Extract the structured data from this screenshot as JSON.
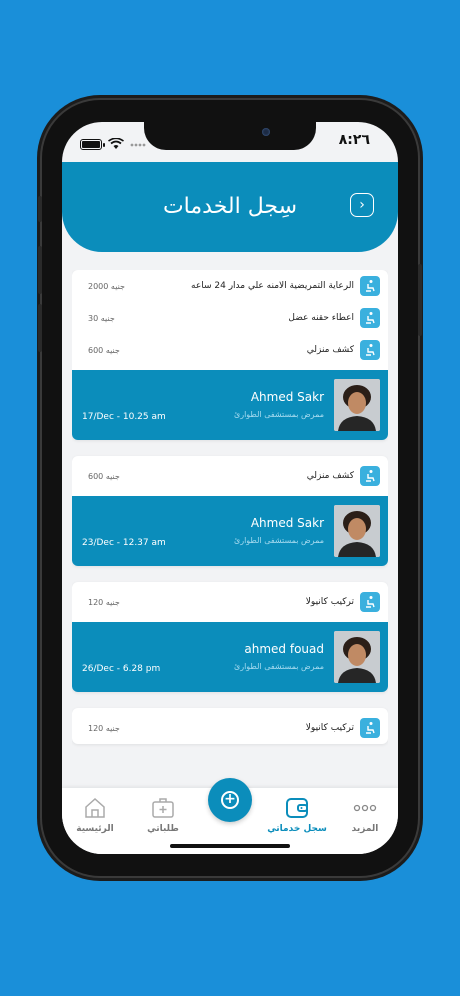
{
  "status": {
    "time": "٨:٢٦"
  },
  "header": {
    "title": "سِجل الخدمات",
    "back_icon": "chevron-right-icon"
  },
  "cards": [
    {
      "services": [
        {
          "name": "الرعاية التمريضية الامنه علي مدار 24 ساعه",
          "price": "2000 جنيه"
        },
        {
          "name": "اعطاء حقنه عضل",
          "price": "30 جنيه"
        },
        {
          "name": "كشف منزلي",
          "price": "600 جنيه"
        }
      ],
      "provider": {
        "name": "Ahmed Sakr",
        "location": "ممرض بمستشفى الطوارئ",
        "date": "17/Dec - 10.25 am"
      }
    },
    {
      "services": [
        {
          "name": "كشف منزلي",
          "price": "600 جنيه"
        }
      ],
      "provider": {
        "name": "Ahmed Sakr",
        "location": "ممرض بمستشفى الطوارئ",
        "date": "23/Dec - 12.37 am"
      }
    },
    {
      "services": [
        {
          "name": "تركيب كانيولا",
          "price": "120 جنيه"
        }
      ],
      "provider": {
        "name": "ahmed fouad",
        "location": "ممرض بمستشفى الطوارئ",
        "date": "26/Dec - 6.28 pm"
      }
    },
    {
      "services": [
        {
          "name": "تركيب كانيولا",
          "price": "120 جنيه"
        }
      ]
    }
  ],
  "nav": {
    "more": "المزيد",
    "history": "سجل خدماتي",
    "add_icon": "plus-icon",
    "requests": "طلباتي",
    "home": "الرئيسية"
  },
  "colors": {
    "primary": "#0b8dbb",
    "icon_bg": "#3ab0de",
    "background": "#1a8fd9"
  }
}
